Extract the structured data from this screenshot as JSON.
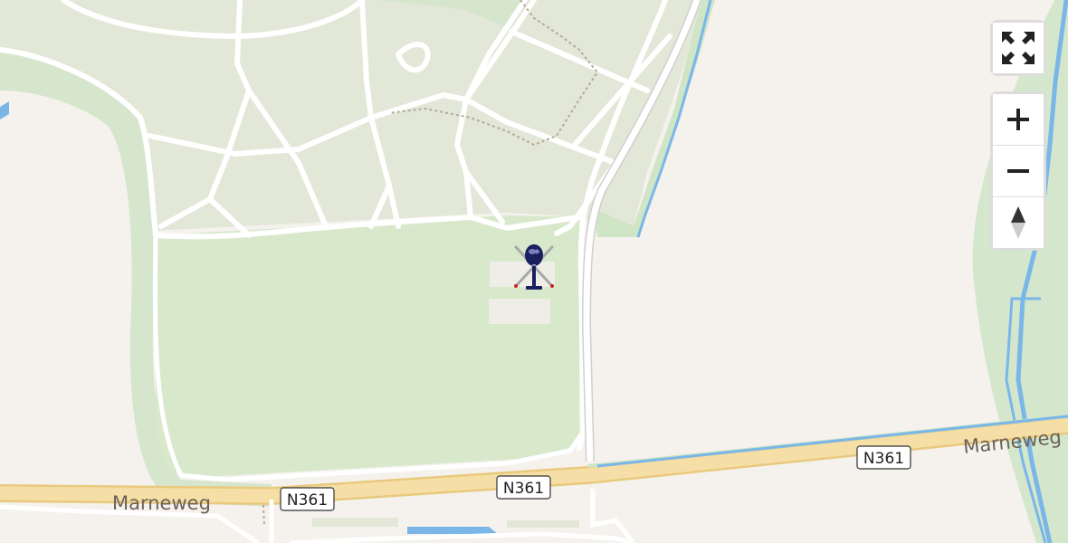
{
  "map": {
    "street_label_left": "Marneweg",
    "street_label_right": "Marneweg",
    "shields": [
      "N361",
      "N361",
      "N361"
    ],
    "colors": {
      "land": "#f5f2ee",
      "park_green": "#e3e8da",
      "grass_green": "#d9e8cc",
      "buffer_green": "#cde5c5",
      "water": "#7ab6e8",
      "road_white": "#ffffff",
      "highway_fill": "#f5dfa6",
      "highway_casing": "#e9c97e",
      "path_dotted": "#b8a898",
      "helicopter_body": "#1b1f5e"
    }
  },
  "marker": {
    "icon": "helicopter-icon"
  },
  "controls": {
    "fullscreen_icon": "fullscreen-icon",
    "zoom_in_icon": "plus-icon",
    "zoom_out_icon": "minus-icon",
    "compass_icon": "compass-icon"
  }
}
